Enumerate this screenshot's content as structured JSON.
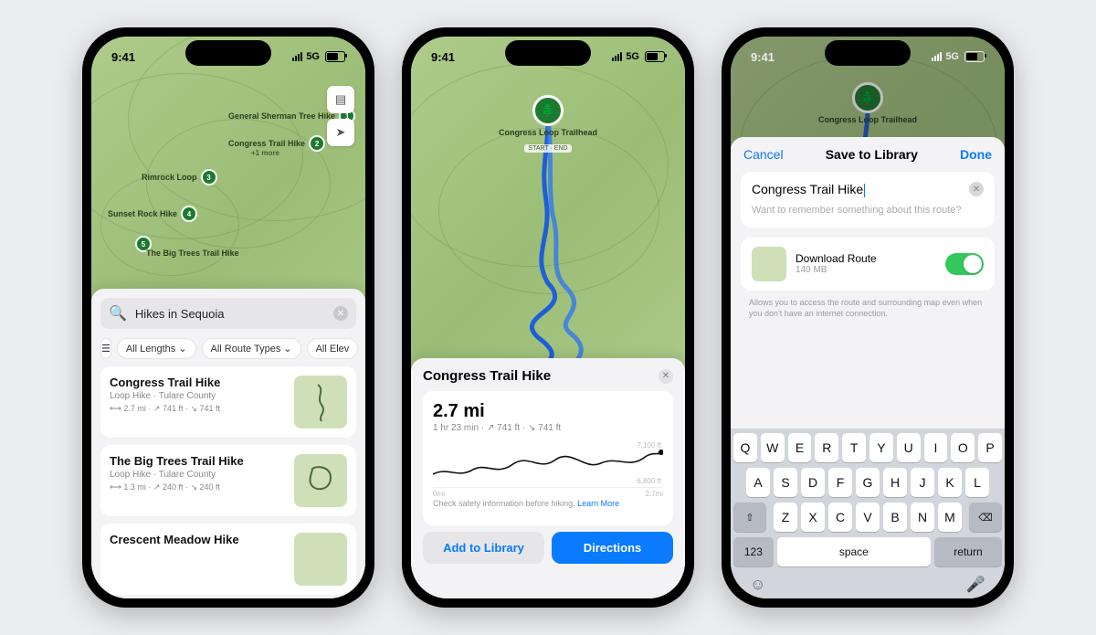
{
  "status": {
    "time": "9:41",
    "network": "5G"
  },
  "phone1": {
    "map_pins": [
      "General Sherman Tree Hike",
      "Congress Trail Hike",
      "Rimrock Loop",
      "Sunset Rock Hike",
      "The Big Trees Trail Hike"
    ],
    "more_label": "+1 more",
    "search_value": "Hikes in Sequoia",
    "filters": {
      "lengths": "All Lengths",
      "types": "All Route Types",
      "elev": "All Elev"
    },
    "results": [
      {
        "title": "Congress Trail Hike",
        "subtitle": "Loop Hike · Tulare County",
        "stats": "⟷ 2.7 mi · ↗ 741 ft · ↘ 741 ft"
      },
      {
        "title": "The Big Trees Trail Hike",
        "subtitle": "Loop Hike · Tulare County",
        "stats": "⟷ 1.3 mi · ↗ 240 ft · ↘ 240 ft"
      },
      {
        "title": "Crescent Meadow Hike",
        "subtitle": "",
        "stats": ""
      }
    ]
  },
  "phone2": {
    "trailhead": {
      "name": "Congress Loop Trailhead",
      "startend": "START · END"
    },
    "title": "Congress Trail Hike",
    "distance": "2.7 mi",
    "detail_line": "1 hr 23 min · ↗ 741 ft · ↘ 741 ft",
    "elev_y_top": "7,100 ft",
    "elev_y_bot": "6,800 ft",
    "elev_x_left": "0mi",
    "elev_x_right": "2.7mi",
    "safety": "Check safety information before hiking.",
    "learn_more": "Learn More",
    "btn_library": "Add to Library",
    "btn_directions": "Directions"
  },
  "phone3": {
    "cancel": "Cancel",
    "title": "Save to Library",
    "done": "Done",
    "name_value": "Congress Trail Hike",
    "note_placeholder": "Want to remember something about this route?",
    "download_label": "Download Route",
    "download_size": "140 MB",
    "download_on": true,
    "hint": "Allows you to access the route and surrounding map even when you don't have an internet connection.",
    "keyboard": {
      "r1": [
        "Q",
        "W",
        "E",
        "R",
        "T",
        "Y",
        "U",
        "I",
        "O",
        "P"
      ],
      "r2": [
        "A",
        "S",
        "D",
        "F",
        "G",
        "H",
        "J",
        "K",
        "L"
      ],
      "r3": [
        "Z",
        "X",
        "C",
        "V",
        "B",
        "N",
        "M"
      ],
      "num": "123",
      "space": "space",
      "ret": "return"
    }
  }
}
